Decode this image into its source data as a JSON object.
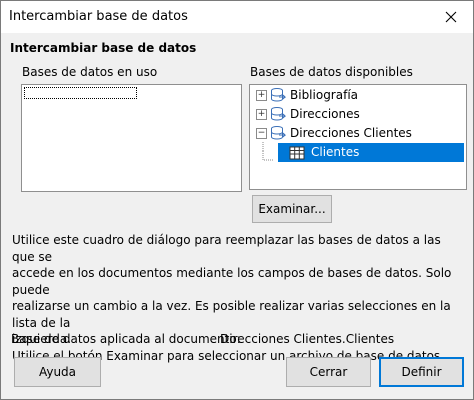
{
  "window": {
    "title": "Intercambiar base de datos"
  },
  "section": {
    "title": "Intercambiar base de datos"
  },
  "left": {
    "label": "Bases de datos en uso"
  },
  "right": {
    "label": "Bases de datos disponibles",
    "tree": [
      {
        "label": "Bibliografía",
        "expander": "+",
        "icon": "database-icon"
      },
      {
        "label": "Direcciones",
        "expander": "+",
        "icon": "database-icon"
      },
      {
        "label": "Direcciones Clientes",
        "expander": "−",
        "icon": "database-icon"
      },
      {
        "label": "Clientes",
        "icon": "table-icon",
        "selected": true
      }
    ]
  },
  "buttons": {
    "browse": "Examinar...",
    "help": "Ayuda",
    "close": "Cerrar",
    "define": "Definir"
  },
  "description": {
    "line1": "Utilice este cuadro de diálogo para reemplazar las bases de datos a las que se",
    "line2": "accede en los documentos mediante los campos de bases de datos. Solo puede",
    "line3": "realizarse un cambio a la vez. Es posible realizar varias selecciones en la lista de la",
    "line4": "izquierda.",
    "line5": "Utilice el botón Examinar para seleccionar un archivo de base de datos."
  },
  "applied": {
    "label": "Base de datos aplicada al documento:",
    "value": "Direcciones Clientes.Clientes"
  },
  "colors": {
    "selection": "#0078d7",
    "window_bg": "#f0f0f0"
  }
}
